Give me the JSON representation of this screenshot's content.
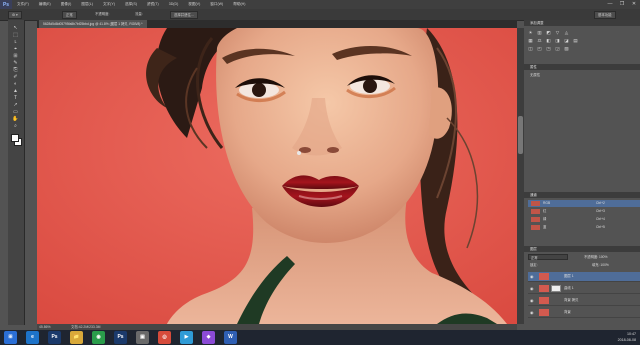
{
  "app": {
    "logo": "Ps",
    "menu": [
      "文件(F)",
      "编辑(E)",
      "图像(I)",
      "图层(L)",
      "文字(Y)",
      "选择(S)",
      "滤镜(T)",
      "3D(D)",
      "视图(V)",
      "窗口(W)",
      "帮助(H)"
    ],
    "window_controls": [
      "—",
      "❐",
      "✕"
    ]
  },
  "options": {
    "mode_label": "正常",
    "opacity_label": "不透明度:",
    "flow_label": "流量:",
    "select_and_mask": "选择并遮住...",
    "workspace": "基本功能"
  },
  "document": {
    "tab_label": "5628d5d8d05795fa5b7bf25bbd.jpg @ 41.8% (图层 1 拷贝, RGB/8) *",
    "zoom": "45.86%",
    "doc_info": "文档:42.2M/233.3M"
  },
  "tools": [
    "↖",
    "⬚",
    "ʟ",
    "⌖",
    "⊞",
    "✎",
    "⎘",
    "✐",
    "◐",
    "▲",
    "T",
    "↗",
    "▭",
    "✋",
    "⌕"
  ],
  "panels": {
    "adjust_title": "添加调整",
    "adjust_rows": [
      [
        "☀",
        "▥",
        "◩",
        "▽",
        "◬"
      ],
      [
        "▦",
        "⚖",
        "◧",
        "◨",
        "◪",
        "▤"
      ],
      [
        "◫",
        "◰",
        "◳",
        "◲",
        "▧"
      ]
    ],
    "properties_title": "属性",
    "properties_sub": "无属性",
    "channels_title": "通道",
    "channels": [
      {
        "name": "RGB",
        "key": "Ctrl+2"
      },
      {
        "name": "红",
        "key": "Ctrl+3"
      },
      {
        "name": "绿",
        "key": "Ctrl+4"
      },
      {
        "name": "蓝",
        "key": "Ctrl+5"
      }
    ],
    "layers_title": "图层",
    "layers_blend": "正常",
    "layers_opacity": "不透明度: 100%",
    "layers_lock": "锁定:",
    "layers_fill": "填充: 100%",
    "layers": [
      {
        "name": "图层 1",
        "has_mask": false
      },
      {
        "name": "曲线 1",
        "has_mask": true
      },
      {
        "name": "背景 拷贝",
        "has_mask": false
      },
      {
        "name": "背景",
        "has_mask": false
      }
    ]
  },
  "taskbar": {
    "icons": [
      {
        "glyph": "⊞",
        "color": "#2b6fd6"
      },
      {
        "glyph": "e",
        "color": "#1d73c9"
      },
      {
        "glyph": "Ps",
        "color": "#1b3a6b"
      },
      {
        "glyph": "📁",
        "color": "#d8a93a"
      },
      {
        "glyph": "◉",
        "color": "#2a9d4b"
      },
      {
        "glyph": "Ps",
        "color": "#1b3a6b"
      },
      {
        "glyph": "▣",
        "color": "#6a6a6a"
      },
      {
        "glyph": "◎",
        "color": "#d64b3b"
      },
      {
        "glyph": "▶",
        "color": "#2f9bd6"
      },
      {
        "glyph": "◆",
        "color": "#8b4bd6"
      },
      {
        "glyph": "W",
        "color": "#2f5fb3"
      }
    ],
    "time": "10:47",
    "date": "2018-08-08"
  }
}
